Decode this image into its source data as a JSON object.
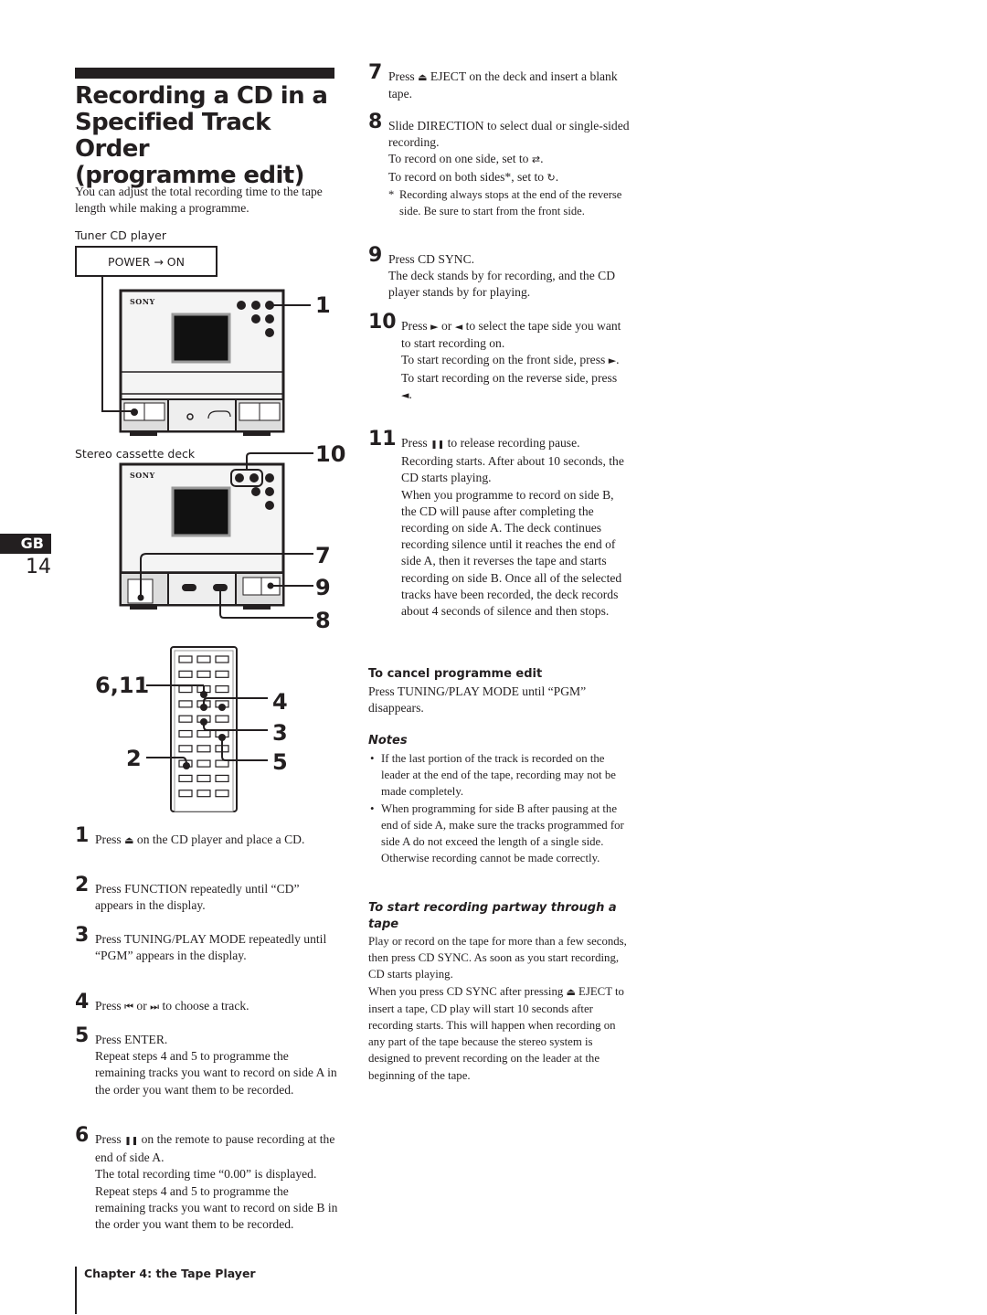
{
  "header": {
    "title_lines": [
      "Recording a CD in a",
      "Specified Track Order",
      "(programme edit)"
    ],
    "intro": "You can adjust the total recording time to the tape length while making a programme."
  },
  "diagram": {
    "tuner_label": "Tuner CD player",
    "power_box": "POWER → ON",
    "brand": "SONY",
    "deck_label": "Stereo cassette deck",
    "callouts": {
      "c1": "1",
      "c10": "10",
      "c7": "7",
      "c9": "9",
      "c8": "8",
      "c6_11": "6,11",
      "c4": "4",
      "c3": "3",
      "c2": "2",
      "c5": "5"
    }
  },
  "side_tab": {
    "lang": "GB",
    "page": "14"
  },
  "icons": {
    "eject": "⏏",
    "prev": "⏮",
    "next": "⏭",
    "pause": "❚❚",
    "play_fwd": "►",
    "play_rev": "◄",
    "one_side": "⇄",
    "both_sides": "↻"
  },
  "steps_left": [
    {
      "num": "1",
      "pre": "Press ",
      "icon": "⏏",
      "post": " on the CD player and place a CD."
    },
    {
      "num": "2",
      "text": "Press FUNCTION repeatedly until “CD” appears in the display."
    },
    {
      "num": "3",
      "text": "Press TUNING/PLAY MODE repeatedly until “PGM” appears in the display."
    },
    {
      "num": "4",
      "pre": "Press ",
      "icon": "⏮",
      "mid": " or ",
      "icon2": "⏭",
      "post": " to choose a track."
    },
    {
      "num": "5",
      "lines": [
        "Press ENTER.",
        "Repeat steps 4 and 5 to programme the remaining tracks you want to record on side A in the order you want them to be recorded."
      ]
    },
    {
      "num": "6",
      "pre": "Press ",
      "icon": "❚❚",
      "post": " on the remote to pause recording at the end of side A.",
      "lines": [
        "The total recording time “0.00” is displayed.",
        "Repeat steps 4 and 5 to programme the remaining tracks you want to record on side B in the order you want them to be recorded."
      ]
    }
  ],
  "steps_right": [
    {
      "num": "7",
      "pre": "Press ",
      "icon": "⏏",
      "post": " EJECT on the deck and insert a blank tape."
    },
    {
      "num": "8",
      "text": "Slide DIRECTION to select dual or single-sided recording.",
      "one_side": "To record on one side, set to ",
      "both_sides": "To record on both sides*, set to ",
      "footnote_star": "*",
      "footnote": "Recording always stops at the end of the reverse side.  Be sure to start from the front side."
    },
    {
      "num": "9",
      "lines": [
        "Press CD SYNC.",
        "The deck stands by for recording, and the CD player stands by for playing."
      ]
    },
    {
      "num": "10",
      "pre": "Press ",
      "mid": " or ",
      "post": " to select the tape side you want to start recording on.",
      "front": "To start recording on the front side, press ",
      "reverse": "To start recording on the reverse side, press "
    },
    {
      "num": "11",
      "pre": "Press ",
      "post": " to release recording pause.",
      "lines": [
        "Recording starts.  After about 10 seconds, the CD starts playing.",
        "When you programme to record on side B, the CD will pause after completing the recording on side A.  The deck continues recording silence until it reaches the end of side A, then it reverses the tape and starts recording on side B.  Once all of the selected tracks have been recorded, the deck records about 4 seconds of silence and then stops."
      ]
    }
  ],
  "cancel": {
    "heading": "To cancel programme edit",
    "text": "Press TUNING/PLAY MODE until “PGM” disappears."
  },
  "notes": {
    "heading": "Notes",
    "items": [
      "If the last portion of the track is recorded on the leader at the end of the tape, recording may not be made completely.",
      "When programming for side B after pausing at the end of side A, make sure the tracks programmed for side A  do not exceed the length of a single side.  Otherwise recording cannot be made correctly."
    ]
  },
  "partway": {
    "heading": "To start recording partway through a tape",
    "p1": "Play or record on the tape for more than a few seconds, then press CD SYNC.  As soon as you start recording, CD starts playing.",
    "p2_pre": "When you press CD SYNC after pressing ",
    "p2_post": " EJECT to insert a tape, CD play will start 10 seconds after recording starts.  This will happen when recording on any part of the tape because the stereo system is designed to prevent recording on the leader at the beginning of the tape."
  },
  "footer": {
    "chapter": "Chapter 4: the Tape Player"
  }
}
